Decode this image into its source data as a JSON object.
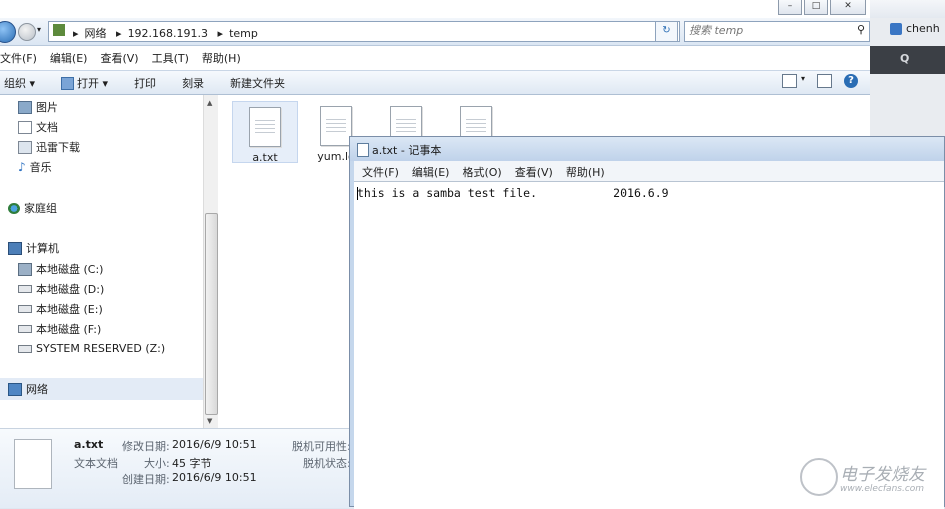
{
  "browser": {
    "tab_text": "chenh",
    "search_glyph": "Q"
  },
  "explorer": {
    "address": {
      "crumbs": [
        "网络",
        "192.168.191.3",
        "temp"
      ]
    },
    "search_placeholder": "搜索 temp",
    "menu": [
      "文件(F)",
      "编辑(E)",
      "查看(V)",
      "工具(T)",
      "帮助(H)"
    ],
    "toolbar": [
      "组织 ▾",
      "打开 ▾",
      "打印",
      "刻录",
      "新建文件夹"
    ],
    "nav": {
      "pictures": "图片",
      "documents": "文档",
      "downloads": "迅雷下载",
      "music": "音乐",
      "homegroup": "家庭组",
      "computer": "计算机",
      "drive_c": "本地磁盘 (C:)",
      "drive_d": "本地磁盘 (D:)",
      "drive_e": "本地磁盘 (E:)",
      "drive_f": "本地磁盘 (F:)",
      "drive_z": "SYSTEM RESERVED (Z:)",
      "network": "网络"
    },
    "files": [
      "a.txt",
      "yum.lo"
    ],
    "details": {
      "name": "a.txt",
      "type": "文本文档",
      "modified_label": "修改日期:",
      "modified_value": "2016/6/9 10:51",
      "size_label": "大小:",
      "size_value": "45 字节",
      "created_label": "创建日期:",
      "created_value": "2016/6/9 10:51",
      "offline_avail_label": "脱机可用性:",
      "offline_status_label": "脱机状态:"
    }
  },
  "notepad": {
    "title": "a.txt - 记事本",
    "menu": [
      "文件(F)",
      "编辑(E)",
      "格式(O)",
      "查看(V)",
      "帮助(H)"
    ],
    "content": "this is a samba test file.           2016.6.9"
  },
  "watermark": {
    "cn": "电子发烧友",
    "url": "www.elecfans.com"
  }
}
